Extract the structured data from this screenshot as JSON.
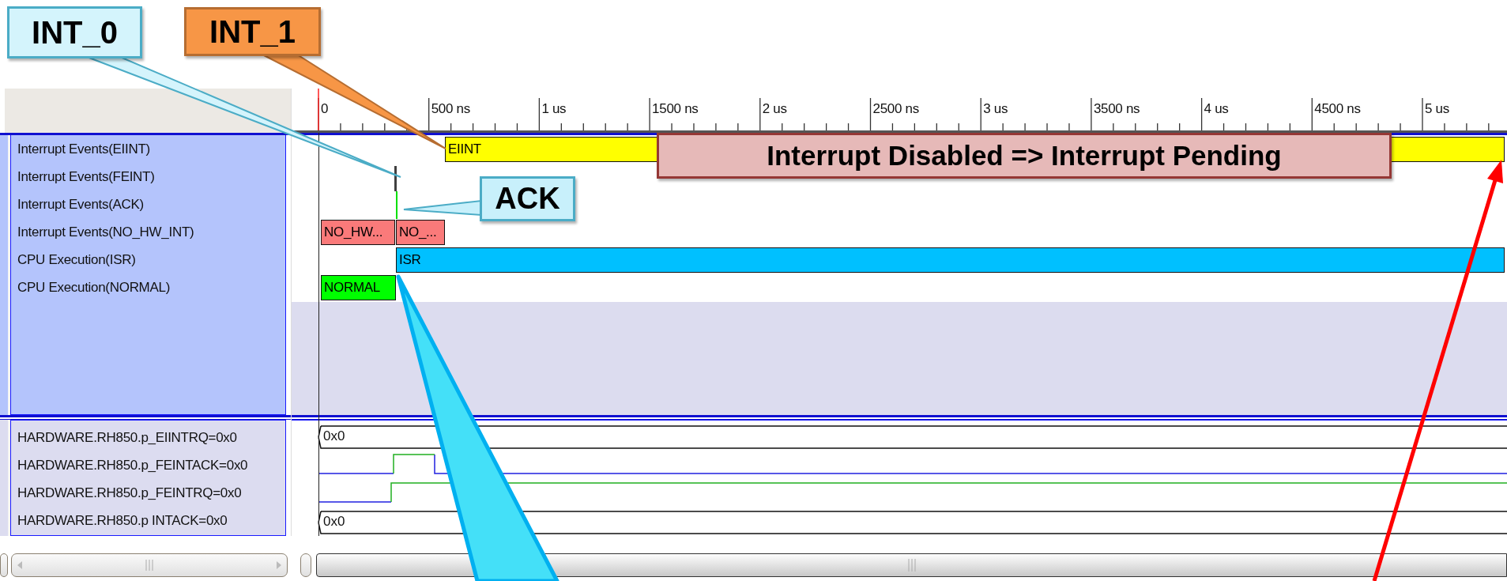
{
  "ruler": {
    "ticks": [
      "0",
      "500 ns",
      "1 us",
      "1500 ns",
      "2 us",
      "2500 ns",
      "3 us",
      "3500 ns",
      "4 us",
      "4500 ns",
      "5 us"
    ]
  },
  "upper_signals": [
    {
      "name": "Interrupt Events(EIINT)",
      "segments": [
        {
          "kind": "bar",
          "label": "EIINT",
          "color": "#ffff00"
        }
      ]
    },
    {
      "name": "Interrupt Events(FEINT)",
      "segments": [
        {
          "kind": "pulse",
          "color": "#404040"
        }
      ]
    },
    {
      "name": "Interrupt Events(ACK)",
      "segments": [
        {
          "kind": "pulse",
          "color": "#00e000"
        }
      ]
    },
    {
      "name": "Interrupt Events(NO_HW_INT)",
      "segments": [
        {
          "kind": "bar",
          "label": "NO_HW...",
          "color": "#fa7a7a"
        },
        {
          "kind": "bar",
          "label": "NO_...",
          "color": "#fa7a7a"
        }
      ]
    },
    {
      "name": "CPU Execution(ISR)",
      "segments": [
        {
          "kind": "bar",
          "label": "ISR",
          "color": "#00c0ff"
        }
      ]
    },
    {
      "name": "CPU Execution(NORMAL)",
      "segments": [
        {
          "kind": "bar",
          "label": "NORMAL",
          "color": "#00ff00"
        }
      ]
    }
  ],
  "lower_signals": [
    {
      "name": "HARDWARE.RH850.p_EIINTRQ=0x0",
      "kind": "bus",
      "value": "0x0"
    },
    {
      "name": "HARDWARE.RH850.p_FEINTACK=0x0",
      "kind": "bit"
    },
    {
      "name": "HARDWARE.RH850.p_FEINTRQ=0x0",
      "kind": "bit"
    },
    {
      "name": "HARDWARE.RH850.p INTACK=0x0",
      "kind": "bus",
      "value": "0x0"
    }
  ],
  "callouts": [
    {
      "kind": "callout",
      "text": "INT_0",
      "color": "#d4f4fc"
    },
    {
      "kind": "callout",
      "text": "INT_1",
      "color": "#f79646"
    },
    {
      "kind": "callout",
      "text": "ACK",
      "color": "#c8f0fb"
    },
    {
      "kind": "banner",
      "text": "Interrupt Disabled => Interrupt Pending",
      "color": "#e6b9b8"
    }
  ]
}
